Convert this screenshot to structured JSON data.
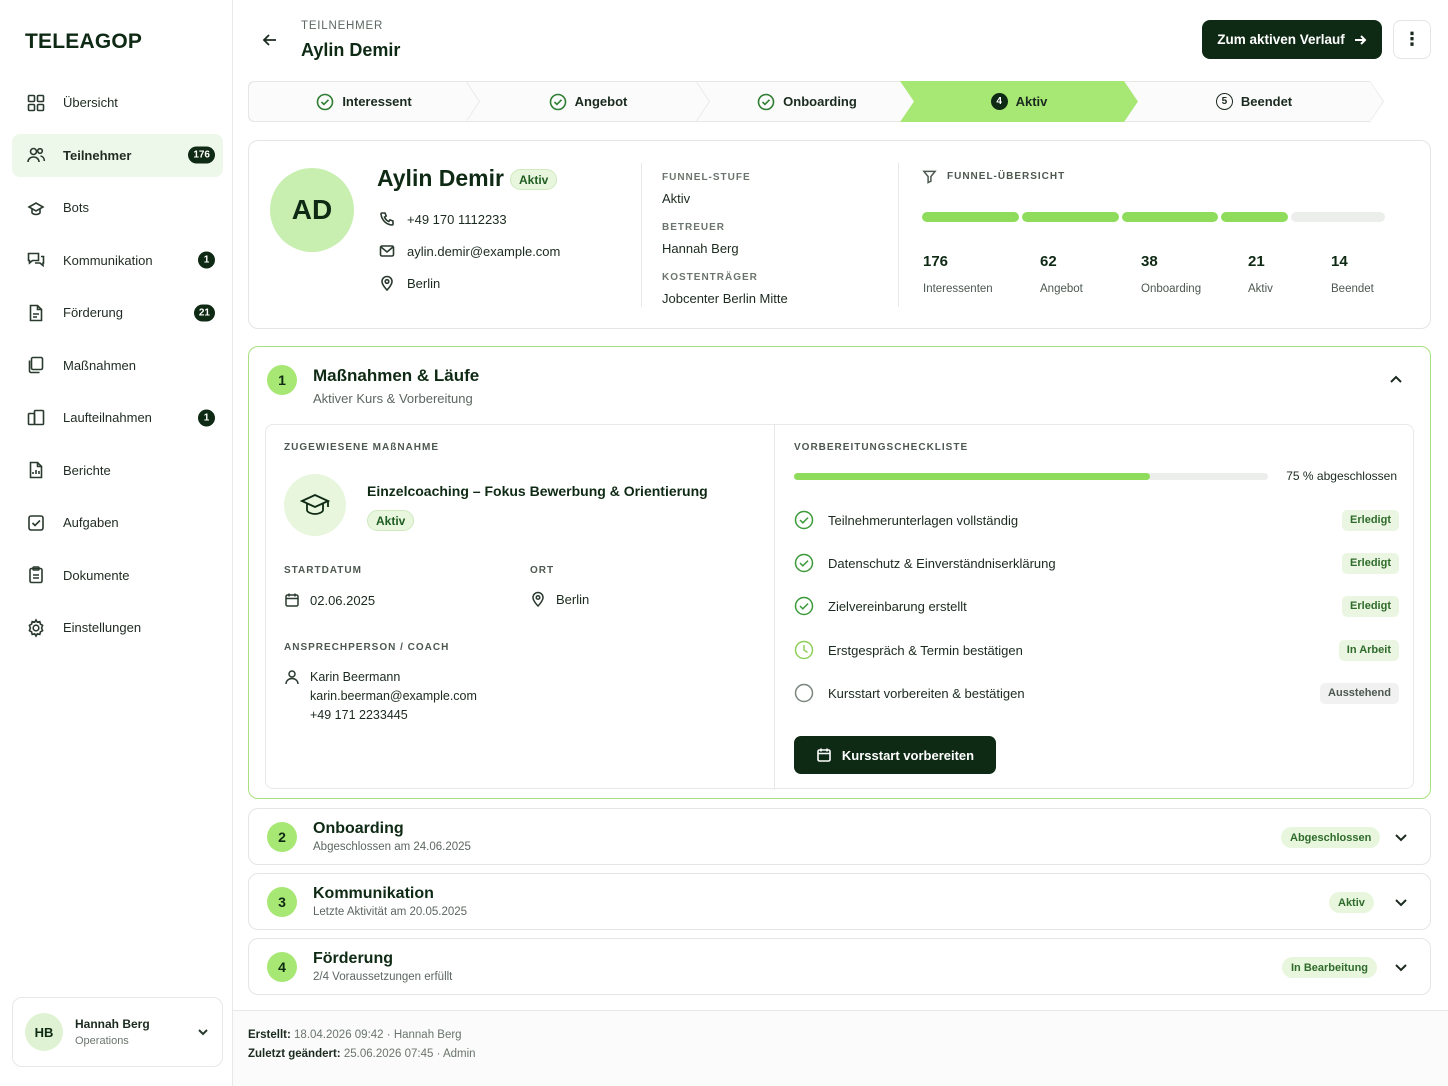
{
  "app": {
    "logo": "TELEAGOP"
  },
  "sidebar": {
    "items": [
      {
        "label": "Übersicht",
        "icon": "grid-icon",
        "badge": ""
      },
      {
        "label": "Teilnehmer",
        "icon": "users-icon",
        "badge": "176",
        "active": true
      },
      {
        "label": "Bots",
        "icon": "bot-icon",
        "badge": ""
      },
      {
        "label": "Kommunikation",
        "icon": "chat-icon",
        "badge": "1"
      },
      {
        "label": "Förderung",
        "icon": "document-icon",
        "badge": "21"
      },
      {
        "label": "Maßnahmen",
        "icon": "copy-icon",
        "badge": ""
      },
      {
        "label": "Laufteilnahmen",
        "icon": "run-icon",
        "badge": "1"
      },
      {
        "label": "Berichte",
        "icon": "report-icon",
        "badge": ""
      },
      {
        "label": "Aufgaben",
        "icon": "task-icon",
        "badge": ""
      },
      {
        "label": "Dokumente",
        "icon": "clipboard-icon",
        "badge": ""
      },
      {
        "label": "Einstellungen",
        "icon": "gear-icon",
        "badge": ""
      }
    ],
    "user": {
      "initials": "HB",
      "name": "Hannah Berg",
      "role": "Operations"
    }
  },
  "header": {
    "eyebrow": "TEILNEHMER",
    "title": "Aylin Demir",
    "primary_button": "Zum aktiven Verlauf",
    "more_button": "⋮"
  },
  "stepper": [
    {
      "label": "Interessent",
      "state": "done"
    },
    {
      "label": "Angebot",
      "state": "done"
    },
    {
      "label": "Onboarding",
      "state": "done"
    },
    {
      "label": "Aktiv",
      "state": "active",
      "num": "4"
    },
    {
      "label": "Beendet",
      "state": "todo",
      "num": "5"
    }
  ],
  "profile": {
    "initials": "AD",
    "name": "Aylin Demir",
    "status": "Aktiv",
    "phone": "+49 170 1112233",
    "email": "aylin.demir@example.com",
    "city": "Berlin",
    "funnel_stage_label": "FUNNEL-STUFE",
    "funnel_stage": "Aktiv",
    "advisor_label": "BETREUER",
    "advisor": "Hannah Berg",
    "payer_label": "KOSTENTRÄGER",
    "payer": "Jobcenter Berlin Mitte"
  },
  "funnel": {
    "title": "FUNNEL-ÜBERSICHT",
    "stats": [
      {
        "value": "176",
        "label": "Interessenten"
      },
      {
        "value": "62",
        "label": "Angebot"
      },
      {
        "value": "38",
        "label": "Onboarding"
      },
      {
        "value": "21",
        "label": "Aktiv"
      },
      {
        "value": "14",
        "label": "Beendet"
      }
    ],
    "filled_segments": 4,
    "total_segments": 5
  },
  "section1": {
    "num": "1",
    "title": "Maßnahmen & Läufe",
    "subtitle": "Aktiver Kurs & Vorbereitung",
    "assigned_label": "ZUGEWIESENE MAßNAHME",
    "measure_title": "Einzelcoaching – Fokus Bewerbung & Orientierung",
    "measure_status": "Aktiv",
    "start_label": "STARTDATUM",
    "start_date": "02.06.2025",
    "place_label": "ORT",
    "place": "Berlin",
    "contact_label": "ANSPRECHPERSON / COACH",
    "coach_name": "Karin Beermann",
    "coach_email": "karin.beerman@example.com",
    "coach_phone": "+49 171 2233445",
    "checklist_label": "VORBEREITUNGSCHECKLISTE",
    "progress_percent": 75,
    "progress_text": "75 % abgeschlossen",
    "checklist": [
      {
        "text": "Teilnehmerunterlagen vollständig",
        "status": "Erledigt",
        "state": "done"
      },
      {
        "text": "Datenschutz & Einverständniserklärung",
        "status": "Erledigt",
        "state": "done"
      },
      {
        "text": "Zielvereinbarung erstellt",
        "status": "Erledigt",
        "state": "done"
      },
      {
        "text": "Erstgespräch & Termin bestätigen",
        "status": "In Arbeit",
        "state": "work"
      },
      {
        "text": "Kursstart vorbereiten & bestätigen",
        "status": "Ausstehend",
        "state": "wait"
      }
    ],
    "cta": "Kursstart vorbereiten"
  },
  "sections": [
    {
      "num": "2",
      "title": "Onboarding",
      "subtitle": "Abgeschlossen am 24.06.2025",
      "badge": "Abgeschlossen"
    },
    {
      "num": "3",
      "title": "Kommunikation",
      "subtitle": "Letzte Aktivität am 20.05.2025",
      "badge": "Aktiv"
    },
    {
      "num": "4",
      "title": "Förderung",
      "subtitle": "2/4 Voraussetzungen erfüllt",
      "badge": "In Bearbeitung"
    }
  ],
  "footer": {
    "created_label": "Erstellt:",
    "created": "18.04.2026 09:42",
    "created_by": "Hannah Berg",
    "changed_label": "Zuletzt geändert:",
    "changed": "25.06.2026 07:45",
    "changed_by": "Admin",
    "separator": "·"
  }
}
